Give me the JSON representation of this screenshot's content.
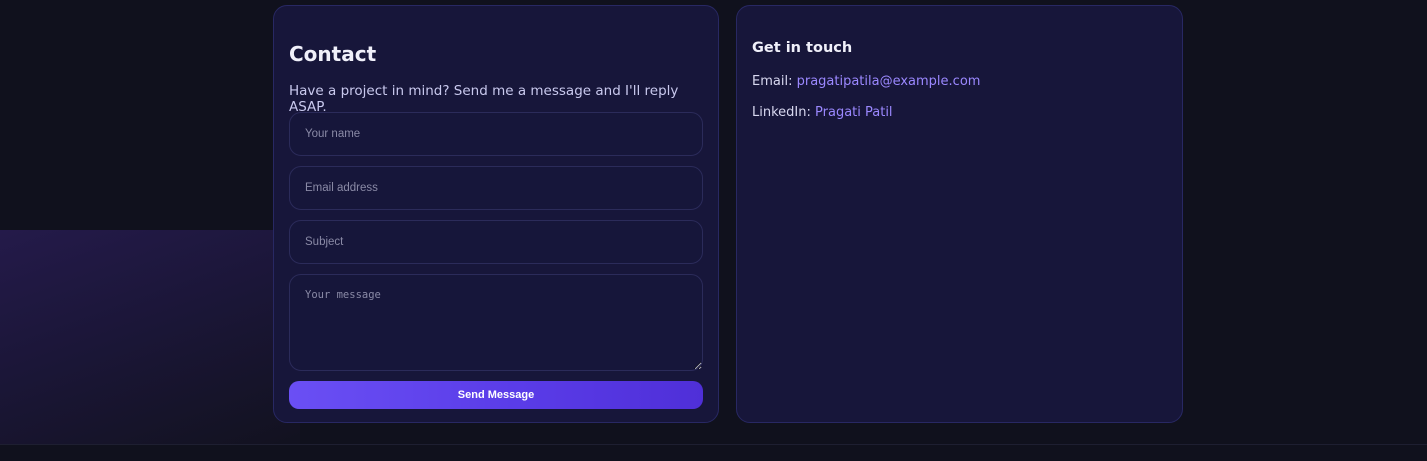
{
  "contact": {
    "title": "Contact",
    "subtitle": "Have a project in mind? Send me a message and I'll reply ASAP.",
    "form": {
      "name_placeholder": "Your name",
      "email_placeholder": "Email address",
      "subject_placeholder": "Subject",
      "message_placeholder": "Your message",
      "submit_label": "Send Message"
    }
  },
  "get_in_touch": {
    "title": "Get in touch",
    "email_label": "Email:",
    "email_value": "pragatipatila@example.com",
    "linkedin_label": "LinkedIn:",
    "linkedin_value": "Pragati Patil"
  },
  "colors": {
    "page_background": "#10111d",
    "card_background": "#17163a",
    "card_border": "#282863",
    "accent": "#6a4ff4",
    "link": "#9b88ff"
  }
}
